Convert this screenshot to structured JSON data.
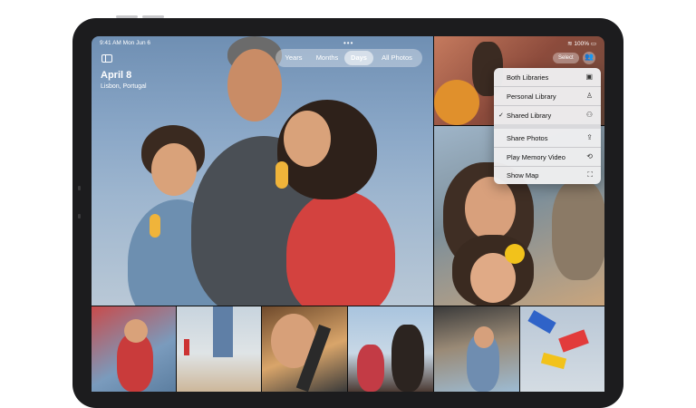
{
  "status": {
    "time": "9:41 AM  Mon Jun 6",
    "battery": "100%"
  },
  "header": {
    "date": "April 8",
    "location": "Lisbon, Portugal"
  },
  "segments": [
    "Years",
    "Months",
    "Days",
    "All Photos"
  ],
  "active_segment": "Days",
  "toolbar": {
    "select_label": "Select"
  },
  "menu": {
    "items": [
      {
        "label": "Both Libraries",
        "icon": "library-icon",
        "checked": false
      },
      {
        "label": "Personal Library",
        "icon": "person-icon",
        "checked": false
      },
      {
        "label": "Shared Library",
        "icon": "people-icon",
        "checked": true
      }
    ],
    "actions": [
      {
        "label": "Share Photos",
        "icon": "share-icon"
      },
      {
        "label": "Play Memory Video",
        "icon": "play-memory-icon"
      },
      {
        "label": "Show Map",
        "icon": "map-icon"
      }
    ],
    "check_glyph": "✓"
  }
}
